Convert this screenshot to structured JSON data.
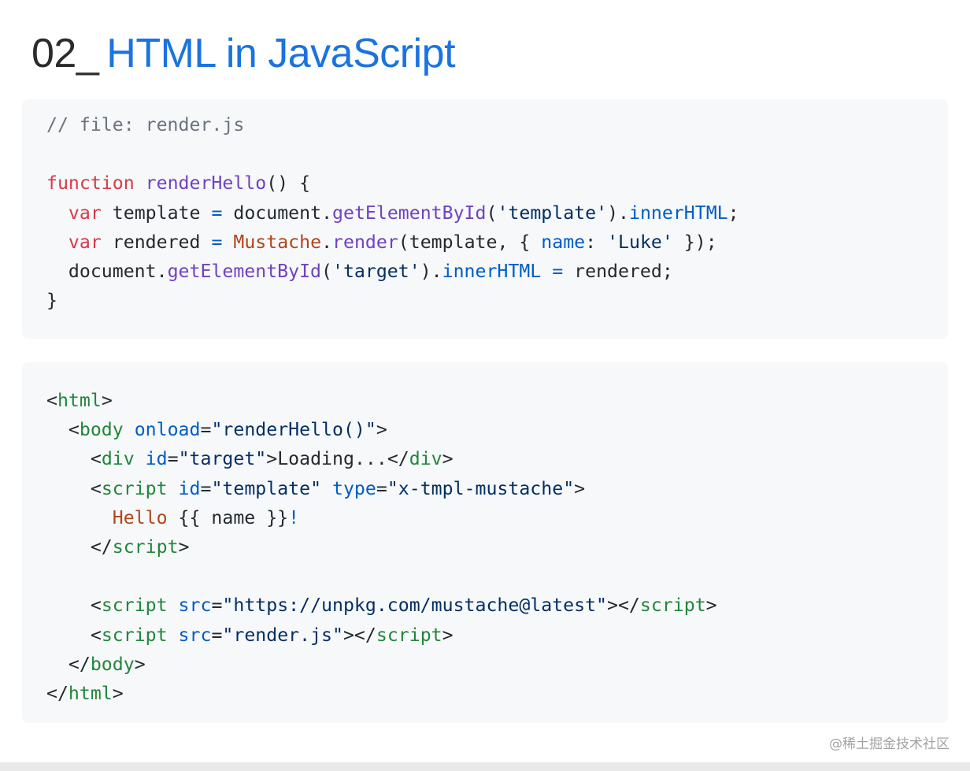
{
  "slide": {
    "number": "02_",
    "title": "HTML in JavaScript"
  },
  "code_js": {
    "comment": "// file: render.js",
    "function_keyword": "function",
    "function_name": "renderHello",
    "line3_var": "var",
    "line3_name": "template",
    "line3_document": "document",
    "line3_method": "getElementById",
    "line3_arg": "'template'",
    "line3_prop": "innerHTML",
    "line4_var": "var",
    "line4_name": "rendered",
    "line4_class": "Mustache",
    "line4_method": "render",
    "line4_arg": "template",
    "line4_key": "name",
    "line4_value": "'Luke'",
    "line5_document": "document",
    "line5_method": "getElementById",
    "line5_arg": "'target'",
    "line5_prop": "innerHTML",
    "line5_value": "rendered"
  },
  "code_html": {
    "tag_html": "html",
    "tag_body": "body",
    "attr_onload": "onload",
    "val_onload": "\"renderHello()\"",
    "tag_div": "div",
    "attr_id": "id",
    "val_target": "\"target\"",
    "div_text": "Loading...",
    "tag_script": "script",
    "val_template": "\"template\"",
    "attr_type": "type",
    "val_type": "\"x-tmpl-mustache\"",
    "hello_word": "Hello",
    "mustache_expr": "{{ name }}",
    "exclamation": "!",
    "attr_src": "src",
    "val_src_unpkg": "\"https://unpkg.com/mustache@latest\"",
    "val_src_render": "\"render.js\""
  },
  "watermark": "@稀土掘金技术社区"
}
